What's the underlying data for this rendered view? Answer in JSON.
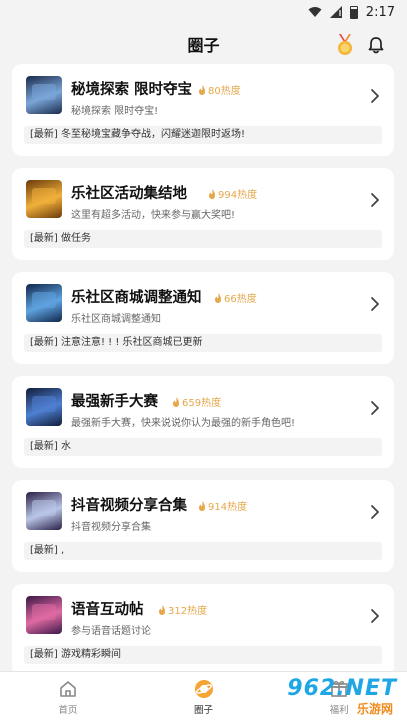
{
  "status_bar": {
    "time": "2:17"
  },
  "header": {
    "title": "圈子"
  },
  "colors": {
    "accent": "#f4a534",
    "heat": "#e6a74a",
    "watermark_blue": "#1ea7e4",
    "watermark_orange": "#f28b1e"
  },
  "cards": [
    {
      "title": "秘境探索 限时夺宝",
      "heat": "80热度",
      "desc": "秘境探索 限时夺宝!",
      "latest": "[最新] 冬至秘境宝藏争夺战，闪耀迷迦限时返场!",
      "thumb_colors": [
        "#1b2a4a",
        "#7aa6d9"
      ]
    },
    {
      "title": "乐社区活动集结地",
      "heat": "994热度",
      "desc": "这里有超多活动，快来参与赢大奖吧!",
      "latest": "[最新] 做任务",
      "thumb_colors": [
        "#6b3a0c",
        "#f0b03a"
      ]
    },
    {
      "title": "乐社区商城调整通知",
      "heat": "66热度",
      "desc": "乐社区商城调整通知",
      "latest": "[最新] 注意注意! ! ! 乐社区商城已更新",
      "thumb_colors": [
        "#10264a",
        "#5fa3e0"
      ]
    },
    {
      "title": "最强新手大赛",
      "heat": "659热度",
      "desc": "最强新手大赛，快来说说你认为最强的新手角色吧!",
      "latest": "[最新] 水",
      "thumb_colors": [
        "#111d3a",
        "#4e7fd1"
      ]
    },
    {
      "title": "抖音视频分享合集",
      "heat": "914热度",
      "desc": "抖音视频分享合集",
      "latest": "[最新] ,",
      "thumb_colors": [
        "#2a1f45",
        "#b9c6e8"
      ]
    },
    {
      "title": "语音互动帖",
      "heat": "312热度",
      "desc": "参与语音话题讨论",
      "latest": "[最新] 游戏精彩瞬间",
      "thumb_colors": [
        "#3a1846",
        "#e06aa3"
      ]
    }
  ],
  "tabs": [
    {
      "label": "首页",
      "icon": "home-icon"
    },
    {
      "label": "圈子",
      "icon": "planet-icon"
    },
    {
      "label": "福利",
      "icon": "gift-icon"
    }
  ],
  "watermark": {
    "text": "962.NET",
    "sub": "乐游网"
  }
}
